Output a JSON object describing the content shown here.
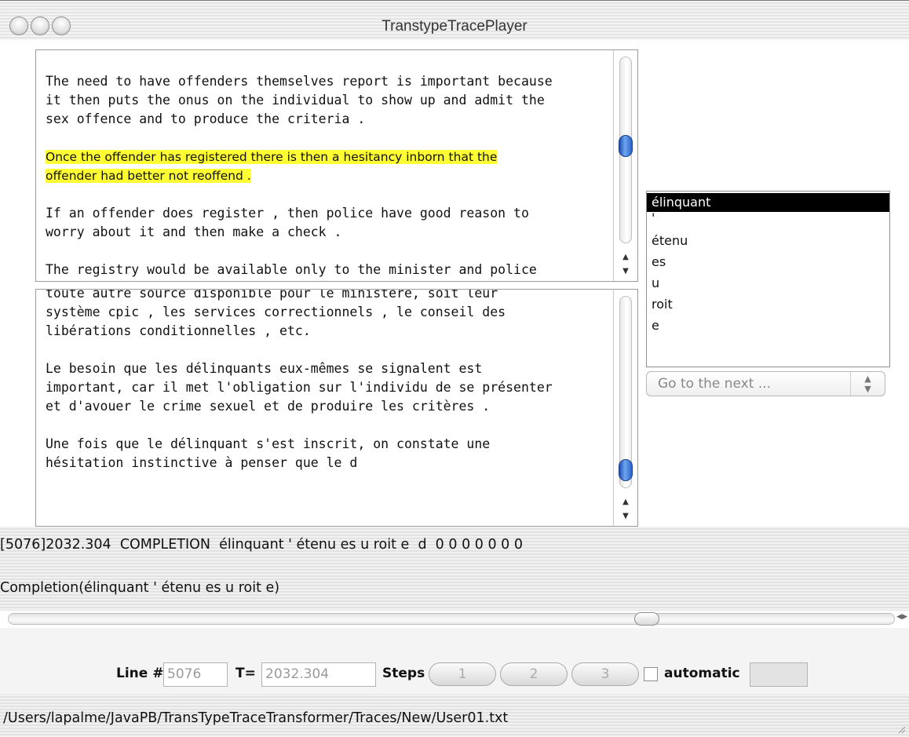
{
  "window": {
    "title": "TranstypeTracePlayer"
  },
  "source_pane": {
    "paragraphs": [
      "The need to have offenders themselves report is important because\nit then puts the onus on the individual to show up and admit the\nsex offence and to produce the criteria .",
      "Once the offender has registered there is then a hesitancy inborn that the\noffender had better not reoffend .",
      "If an offender does register , then police have good reason to\nworry about it and then make a check .",
      "The registry would be available only to the minister and police"
    ]
  },
  "target_pane": {
    "paragraphs": [
      "toute autre source disponible pour le ministère, soit leur\nsystème cpic , les services correctionnels , le conseil des\nlibérations conditionnelles , etc.",
      "Le besoin que les délinquants eux-mêmes se signalent est\nimportant, car il met l'obligation sur l'individu de se présenter\net d'avouer le crime sexuel et de produire les critères .",
      "Une fois que le délinquant s'est inscrit, on constate une\nhésitation instinctive à penser que le d"
    ]
  },
  "completion_list": {
    "items": [
      "élinquant",
      "'",
      "étenu",
      "es",
      "u",
      "roit",
      "e"
    ],
    "selected_index": 0
  },
  "goto_select": {
    "value": "Go to the next ..."
  },
  "trace_line": "[5076]2032.304  COMPLETION  élinquant ' étenu es u roit e  d  0 0 0 0 0 0 0",
  "completion_line": "Completion(élinquant ' étenu es u roit e)",
  "controls": {
    "line_label": "Line #",
    "line_value": "5076",
    "time_label": "T=",
    "time_value": "2032.304",
    "steps_label": "Steps",
    "step_buttons": [
      "1",
      "2",
      "3"
    ],
    "automatic_label": "automatic",
    "automatic_checked": false,
    "extra_value": ""
  },
  "status": {
    "path": "/Users/lapalme/JavaPB/TransTypeTraceTransformer/Traces/New/User01.txt"
  }
}
